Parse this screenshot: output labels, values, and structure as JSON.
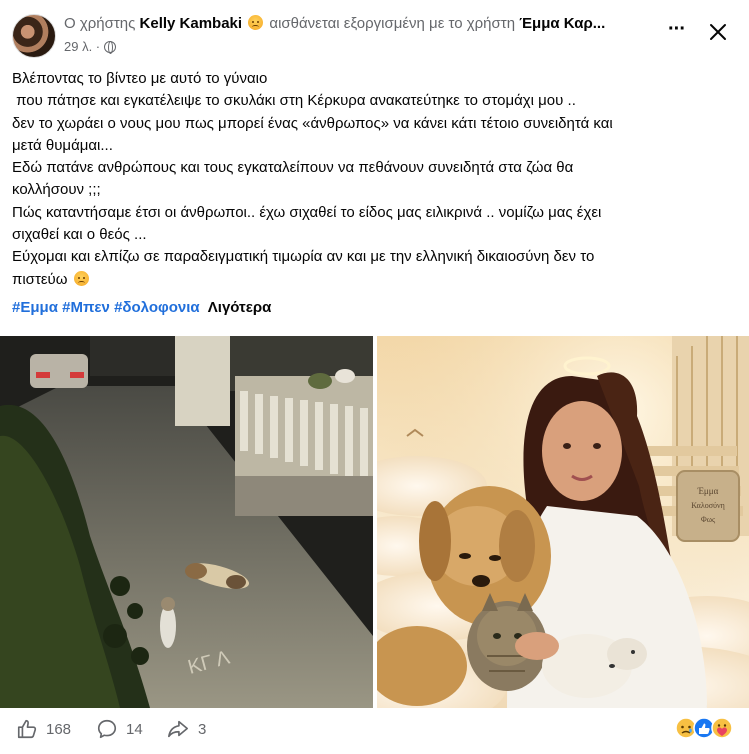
{
  "header": {
    "prefix": "Ο χρήστης",
    "author": "Kelly Kambaki",
    "feeling": "αισθάνεται εξοργισμένη με το χρήστη",
    "tagged": "Έμμα Καρ...",
    "time": "29 λ. ·"
  },
  "post": {
    "lines": [
      "Βλέποντας το βίντεο με αυτό το γύναιο",
      " που πάτησε και εγκατέλειψε το σκυλάκι στη Κέρκυρα ανακατεύτηκε το στομάχι μου ..",
      "δεν το χωράει ο νους μου πως μπορεί ένας «άνθρωπος» να κάνει κάτι τέτοιο συνειδητά και",
      "μετά θυμάμαι...",
      "Εδώ πατάνε ανθρώπους και τους εγκαταλείπουν να πεθάνουν συνειδητά στα ζώα θα",
      "κολλήσουν ;;;",
      "Πώς καταντήσαμε έτσι οι άνθρωποι.. έχω σιχαθεί το είδος μας ειλικρινά .. νομίζω μας έχει",
      "σιχαθεί και ο θεός ...",
      "Εύχομαι και ελπίζω σε παραδειγματική τιμωρία αν και με την ελληνική δικαιοσύνη δεν το",
      "πιστεύω"
    ],
    "tags": [
      "#Εμμα",
      "#Μπεν",
      "#δολοφονια"
    ],
    "more": "Λιγότερα"
  },
  "images": {
    "left_street_text": "ΚΓ   Λ",
    "memorial_text": [
      "Έμμα",
      "Καλοσύνη",
      "Φως"
    ]
  },
  "footer": {
    "likes": "168",
    "comments": "14",
    "shares": "3"
  },
  "icons": {
    "header_emoji": "angry-face-icon",
    "end_emoji": "disappointed-face-icon",
    "reactions": [
      "sad-reaction-icon",
      "like-reaction-icon",
      "care-reaction-icon"
    ]
  },
  "colors": {
    "link": "#216fdb",
    "secondary_text": "#65676b",
    "like_blue": "#1877f2"
  }
}
